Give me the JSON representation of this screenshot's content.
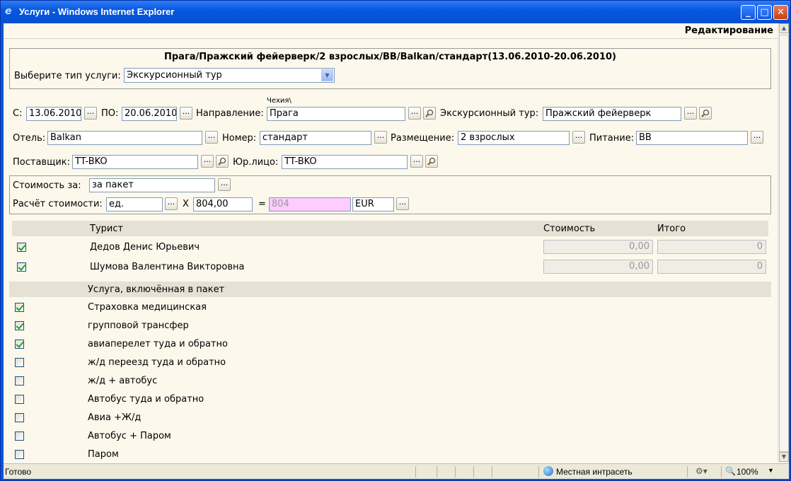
{
  "window": {
    "title": "Услуги - Windows Internet Explorer",
    "min": "_",
    "max": "□",
    "close": "✕"
  },
  "page": {
    "mode": "Редактирование",
    "caption": "Прага/Пражский фейерверк/2 взрослых/BB/Balkan/стандарт(13.06.2010-20.06.2010)"
  },
  "service_type": {
    "label": "Выберите тип услуги:",
    "value": "Экскурсионный тур"
  },
  "dates": {
    "from_label": "С:",
    "from": "13.06.2010",
    "to_label": "ПО:",
    "to": "20.06.2010"
  },
  "direction": {
    "label": "Направление:",
    "hint": "Чехия\\",
    "value": "Прага"
  },
  "tour": {
    "label": "Экскурсионный тур:",
    "value": "Пражский фейерверк"
  },
  "hotel": {
    "label": "Отель:",
    "value": "Balkan"
  },
  "room": {
    "label": "Номер:",
    "value": "стандарт"
  },
  "accommodation": {
    "label": "Размещение:",
    "value": "2 взрослых"
  },
  "meal": {
    "label": "Питание:",
    "value": "BB"
  },
  "supplier": {
    "label": "Поставщик:",
    "value": "TT-BKO"
  },
  "legal": {
    "label": "Юр.лицо:",
    "value": "TT-BKO"
  },
  "cost": {
    "for_label": "Стоимость за:",
    "for_value": "за пакет",
    "calc_label": "Расчёт стоимости:",
    "unit": "ед.",
    "times": "X",
    "price": "804,00",
    "eq": "=",
    "total": "804",
    "currency": "EUR"
  },
  "buttons": {
    "dots": "..."
  },
  "tourists": {
    "headers": {
      "name": "Турист",
      "cost": "Стоимость",
      "total": "Итого"
    },
    "rows": [
      {
        "name": "Дедов Денис Юрьевич",
        "cost": "0,00",
        "total": "0",
        "checked": true
      },
      {
        "name": "Шумова Валентина Викторовна",
        "cost": "0,00",
        "total": "0",
        "checked": true
      }
    ]
  },
  "package": {
    "header": "Услуга, включённая в пакет",
    "items": [
      {
        "label": "Страховка медицинская",
        "checked": true
      },
      {
        "label": "групповой трансфер",
        "checked": true
      },
      {
        "label": "авиаперелет туда и обратно",
        "checked": true
      },
      {
        "label": "ж/д переезд туда и обратно",
        "checked": false
      },
      {
        "label": "ж/д + автобус",
        "checked": false
      },
      {
        "label": "Автобус туда и обратно",
        "checked": false
      },
      {
        "label": "Авиа +Ж/д",
        "checked": false
      },
      {
        "label": "Автобус + Паром",
        "checked": false
      },
      {
        "label": "Паром",
        "checked": false
      }
    ]
  },
  "statusbar": {
    "text": "Готово",
    "zone": "Местная интрасеть",
    "zoom": "100%"
  },
  "colors": {
    "titlebar": "#0858e0",
    "background": "#fcf8ec",
    "highlight": "#ffccff",
    "header_row": "#e6e1d5"
  }
}
